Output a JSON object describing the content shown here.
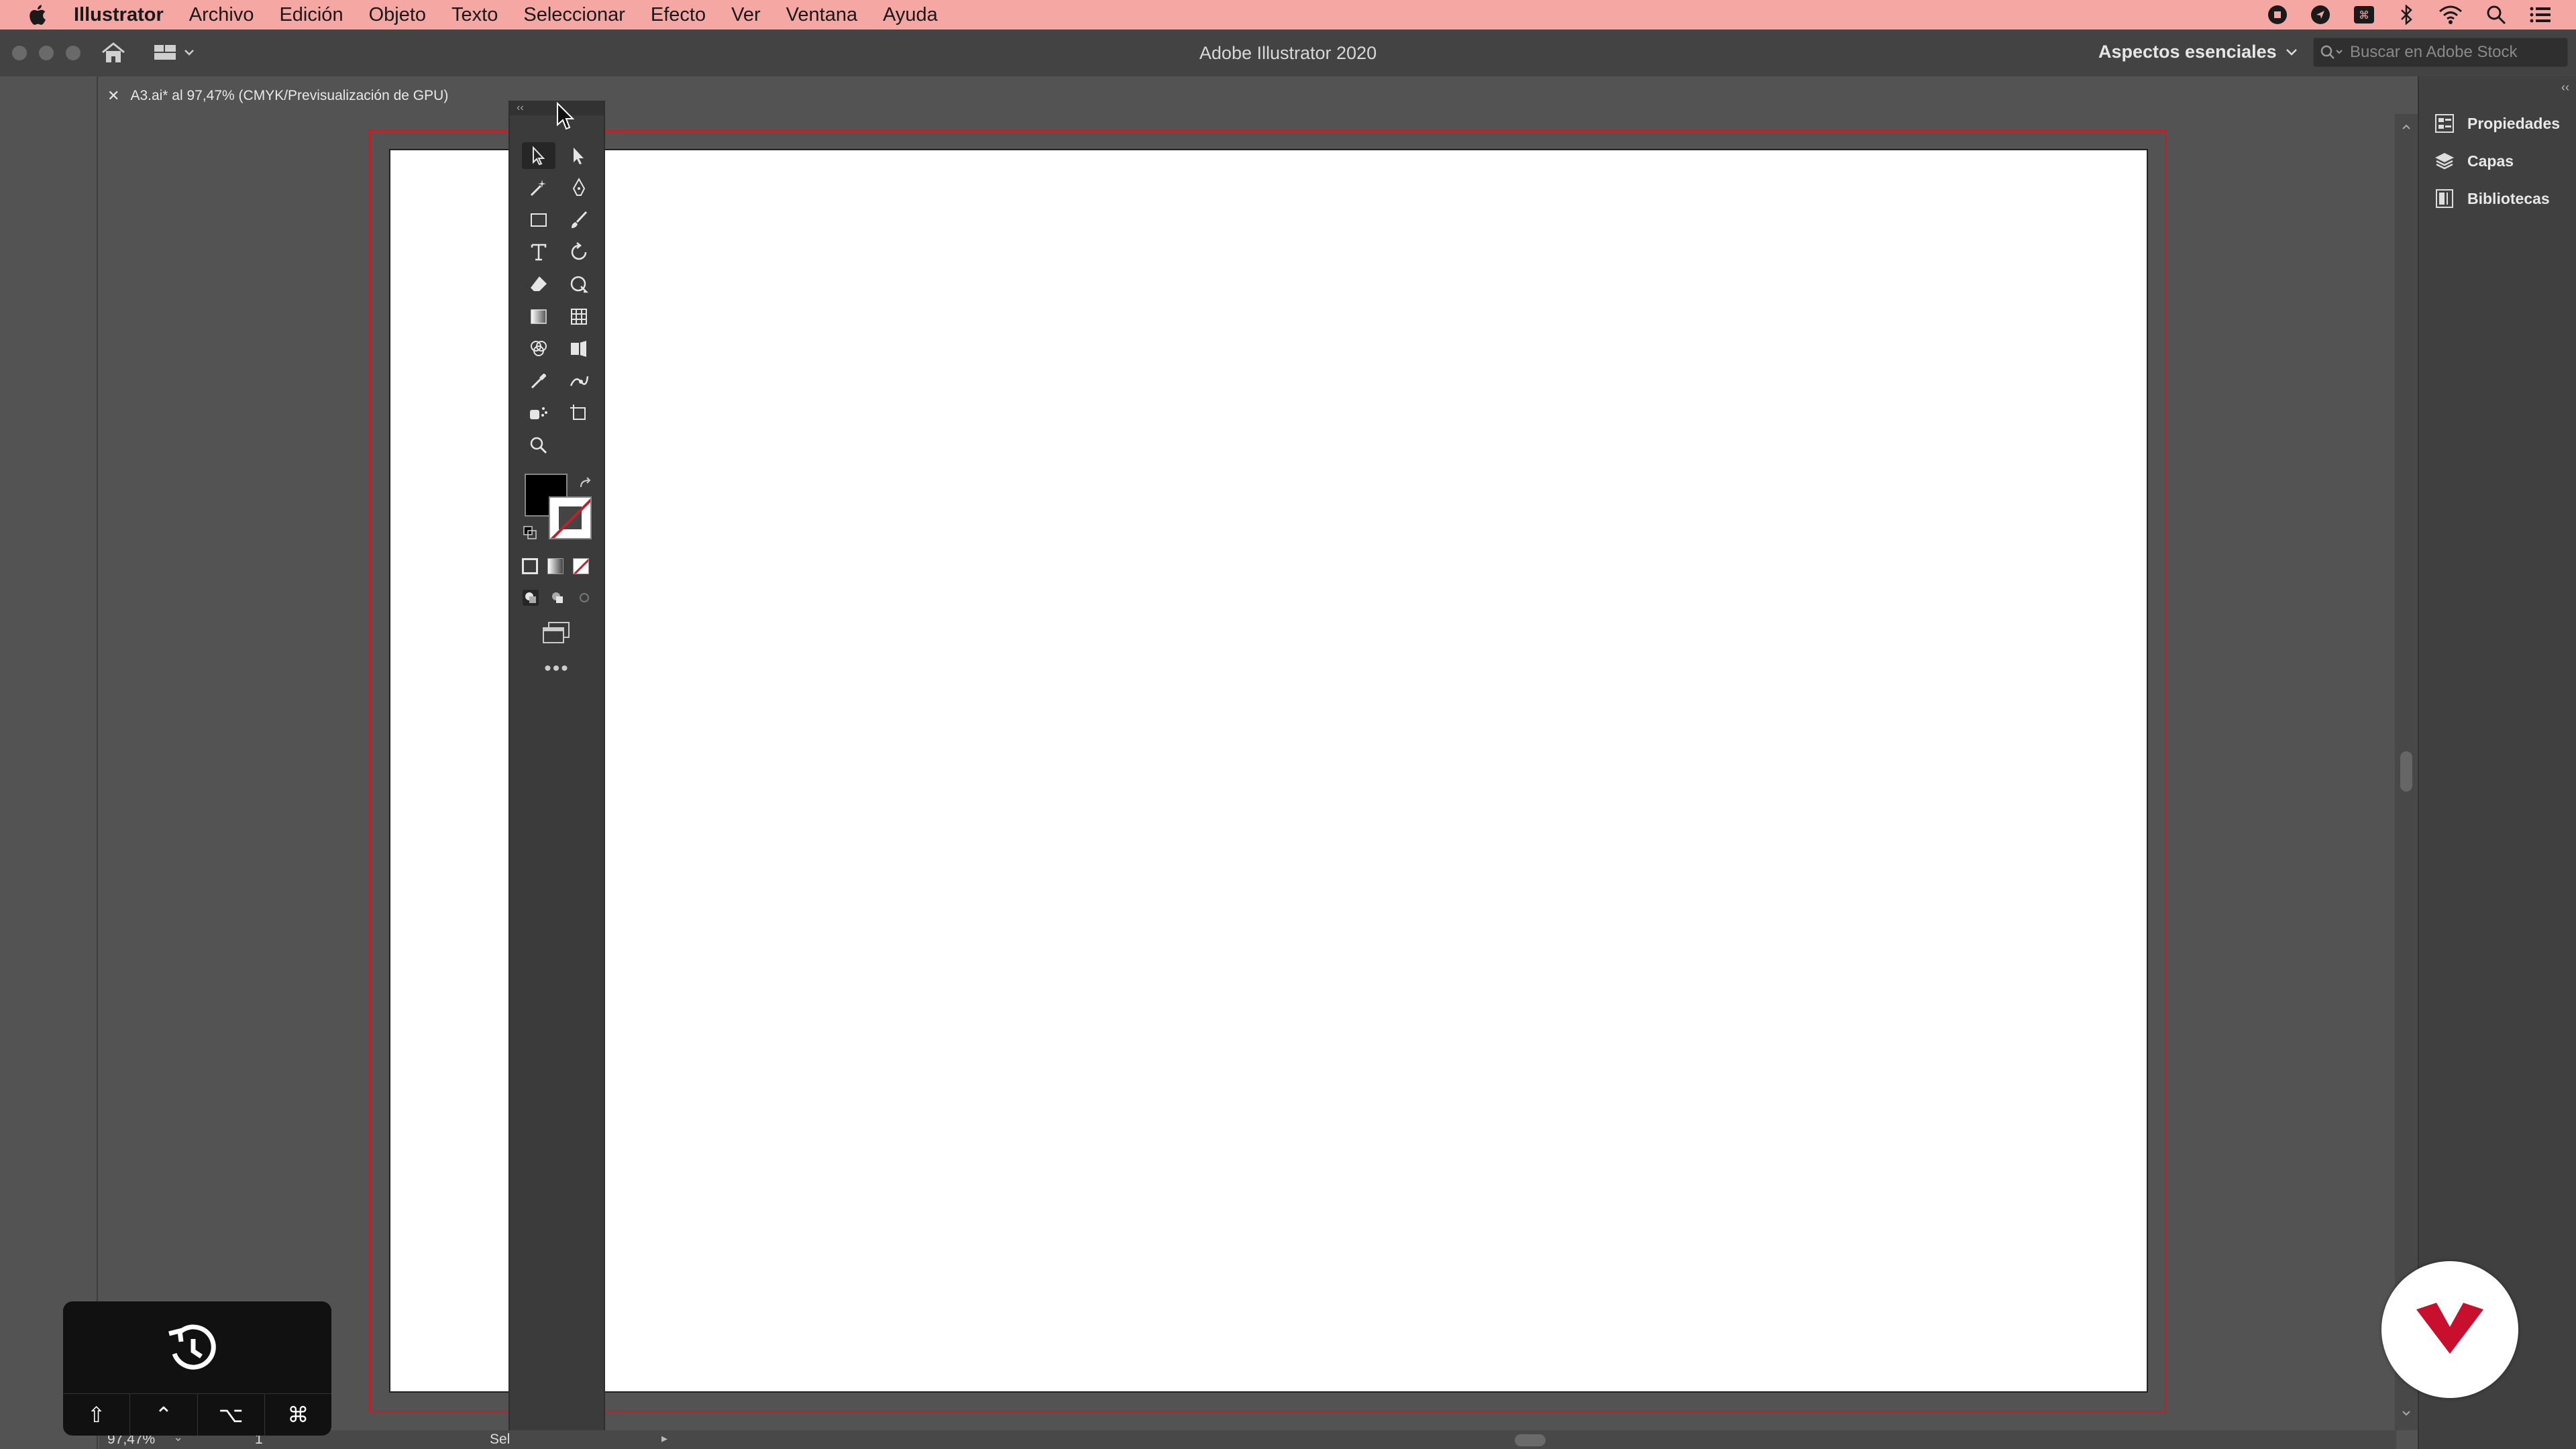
{
  "menubar": {
    "app_name": "Illustrator",
    "items": [
      "Archivo",
      "Edición",
      "Objeto",
      "Texto",
      "Seleccionar",
      "Efecto",
      "Ver",
      "Ventana",
      "Ayuda"
    ]
  },
  "appbar": {
    "title": "Adobe Illustrator 2020",
    "workspace": "Aspectos esenciales",
    "stock_search_placeholder": "Buscar en Adobe Stock"
  },
  "document": {
    "tab_title": "A3.ai* al 97,47% (CMYK/Previsualización de GPU)"
  },
  "right_panels": [
    {
      "label": "Propiedades",
      "icon": "properties-icon"
    },
    {
      "label": "Capas",
      "icon": "layers-icon"
    },
    {
      "label": "Bibliotecas",
      "icon": "libraries-icon"
    }
  ],
  "statusbar": {
    "zoom": "97,47%",
    "artboard_number": "1",
    "status_text": "Sel"
  },
  "overlay": {
    "keys": [
      "⇧",
      "⌃",
      "⌥",
      "⌘"
    ]
  },
  "colors": {
    "menubar": "#f4a7a3",
    "bleed": "#c0202a",
    "brand": "#c8102e"
  }
}
